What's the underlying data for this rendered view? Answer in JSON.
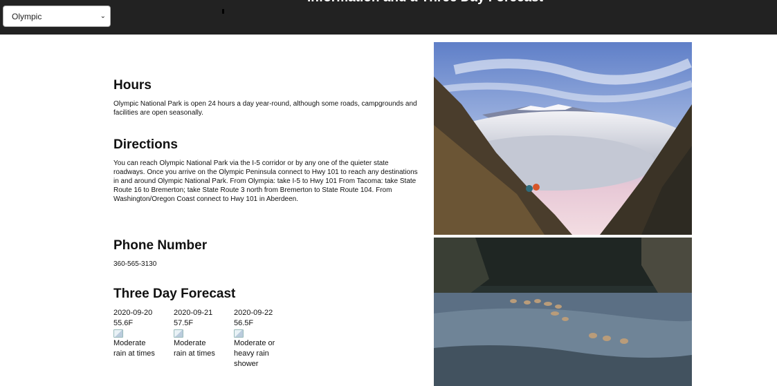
{
  "header": {
    "park_select": {
      "selected": "Olympic"
    },
    "title": "Information and a Three Day Forecast"
  },
  "sections": {
    "hours": {
      "heading": "Hours",
      "text": "Olympic National Park is open 24 hours a day year-round, although some roads, campgrounds and facilities are open seasonally."
    },
    "directions": {
      "heading": "Directions",
      "text": "You can reach Olympic National Park via the I-5 corridor or by any one of the quieter state roadways. Once you arrive on the Olympic Peninsula connect to Hwy 101 to reach any destinations in and around Olympic National Park. From Olympia: take I-5 to Hwy 101 From Tacoma: take State Route 16 to Bremerton; take State Route 3 north from Bremerton to State Route 104. From Washington/Oregon Coast connect to Hwy 101 in Aberdeen."
    },
    "phone": {
      "heading": "Phone Number",
      "value": "360-565-3130"
    },
    "forecast": {
      "heading": "Three Day Forecast",
      "days": [
        {
          "date": "2020-09-20",
          "temp": "55.6F",
          "condition": "Moderate rain at times"
        },
        {
          "date": "2020-09-21",
          "temp": "57.5F",
          "condition": "Moderate rain at times"
        },
        {
          "date": "2020-09-22",
          "temp": "56.5F",
          "condition": "Moderate or heavy rain shower"
        }
      ]
    }
  },
  "colors": {
    "header_bg": "#222222",
    "page_bg": "#ffffff",
    "text": "#111111"
  }
}
